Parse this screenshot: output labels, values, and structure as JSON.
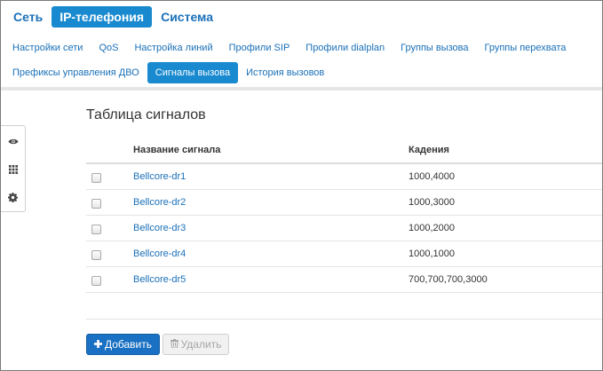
{
  "top_menu": {
    "items": [
      {
        "label": "Сеть",
        "active": false
      },
      {
        "label": "IP-телефония",
        "active": true
      },
      {
        "label": "Система",
        "active": false
      }
    ]
  },
  "sub_menu": {
    "row1": [
      {
        "label": "Настройки сети",
        "active": false
      },
      {
        "label": "QoS",
        "active": false
      },
      {
        "label": "Настройка линий",
        "active": false
      },
      {
        "label": "Профили SIP",
        "active": false
      },
      {
        "label": "Профили dialplan",
        "active": false
      },
      {
        "label": "Группы вызова",
        "active": false
      },
      {
        "label": "Группы перехвата",
        "active": false
      }
    ],
    "row2": [
      {
        "label": "Префиксы управления ДВО",
        "active": false
      },
      {
        "label": "Сигналы вызова",
        "active": true
      },
      {
        "label": "История вызовов",
        "active": false
      }
    ]
  },
  "sidebar": {
    "icons": [
      "eye-icon",
      "grid-icon",
      "gear-icon"
    ]
  },
  "main": {
    "title": "Таблица сигналов",
    "columns": {
      "name": "Название сигнала",
      "cadence": "Кадения"
    },
    "rows": [
      {
        "name": "Bellcore-dr1",
        "cadence": "1000,4000"
      },
      {
        "name": "Bellcore-dr2",
        "cadence": "1000,3000"
      },
      {
        "name": "Bellcore-dr3",
        "cadence": "1000,2000"
      },
      {
        "name": "Bellcore-dr4",
        "cadence": "1000,1000"
      },
      {
        "name": "Bellcore-dr5",
        "cadence": "700,700,700,3000"
      }
    ]
  },
  "buttons": {
    "add_label": "Добавить",
    "add_icon": "plus-icon",
    "delete_label": "Удалить",
    "delete_icon": "trash-icon"
  },
  "colors": {
    "accent": "#1a8ad0",
    "link": "#1a70b8",
    "primary_button": "#1a70c2"
  }
}
